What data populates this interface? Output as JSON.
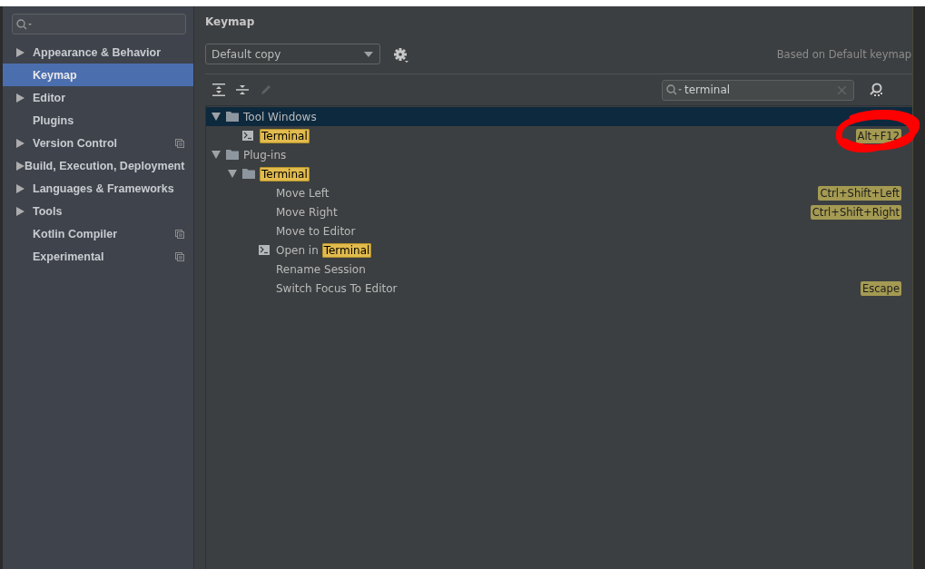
{
  "sidebar": {
    "items": [
      {
        "label": "Appearance & Behavior",
        "expandable": true,
        "selected": false,
        "scoped": false
      },
      {
        "label": "Keymap",
        "expandable": false,
        "selected": true,
        "scoped": false
      },
      {
        "label": "Editor",
        "expandable": true,
        "selected": false,
        "scoped": false
      },
      {
        "label": "Plugins",
        "expandable": false,
        "selected": false,
        "scoped": false
      },
      {
        "label": "Version Control",
        "expandable": true,
        "selected": false,
        "scoped": true
      },
      {
        "label": "Build, Execution, Deployment",
        "expandable": true,
        "selected": false,
        "scoped": false
      },
      {
        "label": "Languages & Frameworks",
        "expandable": true,
        "selected": false,
        "scoped": false
      },
      {
        "label": "Tools",
        "expandable": true,
        "selected": false,
        "scoped": false
      },
      {
        "label": "Kotlin Compiler",
        "expandable": false,
        "selected": false,
        "scoped": true
      },
      {
        "label": "Experimental",
        "expandable": false,
        "selected": false,
        "scoped": true
      }
    ]
  },
  "title": "Keymap",
  "keymap_select": {
    "value": "Default copy"
  },
  "based_on": "Based on Default keymap",
  "filter": {
    "value": "terminal"
  },
  "tree": [
    {
      "kind": "folder",
      "label": [
        {
          "text": "Tool Windows",
          "match": false
        }
      ],
      "selected": true,
      "expanded": true,
      "children": [
        {
          "kind": "terminal",
          "label": [
            {
              "text": "Terminal",
              "match": true
            }
          ],
          "selected": false,
          "shortcut": "Alt+F12"
        }
      ]
    },
    {
      "kind": "folder",
      "label": [
        {
          "text": "Plug-ins",
          "match": false
        }
      ],
      "selected": false,
      "expanded": true,
      "children": [
        {
          "kind": "folder",
          "label": [
            {
              "text": "Terminal",
              "match": true
            }
          ],
          "selected": false,
          "expanded": true,
          "children": [
            {
              "kind": "action",
              "label": [
                {
                  "text": "Move Left",
                  "match": false
                }
              ],
              "selected": false,
              "shortcut": "Ctrl+Shift+Left"
            },
            {
              "kind": "action",
              "label": [
                {
                  "text": "Move Right",
                  "match": false
                }
              ],
              "selected": false,
              "shortcut": "Ctrl+Shift+Right"
            },
            {
              "kind": "action",
              "label": [
                {
                  "text": "Move to Editor",
                  "match": false
                }
              ],
              "selected": false
            },
            {
              "kind": "terminal",
              "label": [
                {
                  "text": "Open in ",
                  "match": false
                },
                {
                  "text": "Terminal",
                  "match": true
                }
              ],
              "selected": false
            },
            {
              "kind": "action",
              "label": [
                {
                  "text": "Rename Session",
                  "match": false
                }
              ],
              "selected": false
            },
            {
              "kind": "action",
              "label": [
                {
                  "text": "Switch Focus To Editor",
                  "match": false
                }
              ],
              "selected": false,
              "shortcut": "Escape"
            }
          ]
        }
      ]
    }
  ]
}
